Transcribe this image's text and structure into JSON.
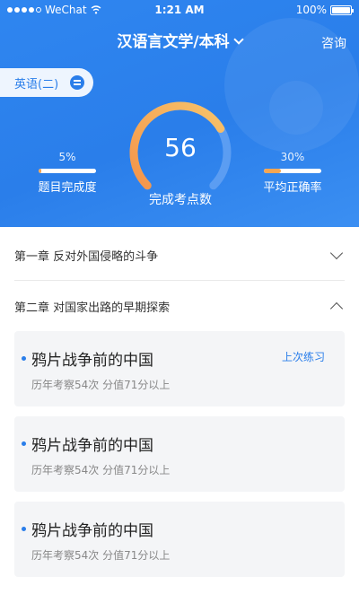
{
  "status_bar": {
    "carrier": "WeChat",
    "time": "1:21 AM",
    "battery": "100%"
  },
  "header": {
    "title": "汉语言文学/本科",
    "consult_label": "咨询",
    "subject": "英语(二)"
  },
  "progress": {
    "completed_points": "56",
    "completed_points_label": "完成考点数",
    "gauge_fraction": 0.72,
    "completion_percent": "5%",
    "completion_value": 0.05,
    "completion_label": "题目完成度",
    "accuracy_percent": "30%",
    "accuracy_value": 0.3,
    "accuracy_label": "平均正确率"
  },
  "colors": {
    "primary": "#2a7eea",
    "gauge_start": "#f4944a",
    "gauge_end": "#f7c36a",
    "gauge_track": "#5b9df2"
  },
  "chapters": [
    {
      "title": "第一章  反对外国侵略的斗争",
      "expanded": false
    },
    {
      "title": "第二章  对国家出路的早期探索",
      "expanded": true
    }
  ],
  "sections": [
    {
      "title": "鸦片战争前的中国",
      "meta": "历年考察54次  分值71分以上",
      "badge": "上次练习"
    },
    {
      "title": "鸦片战争前的中国",
      "meta": "历年考察54次  分值71分以上",
      "badge": ""
    },
    {
      "title": "鸦片战争前的中国",
      "meta": "历年考察54次  分值71分以上",
      "badge": ""
    }
  ]
}
